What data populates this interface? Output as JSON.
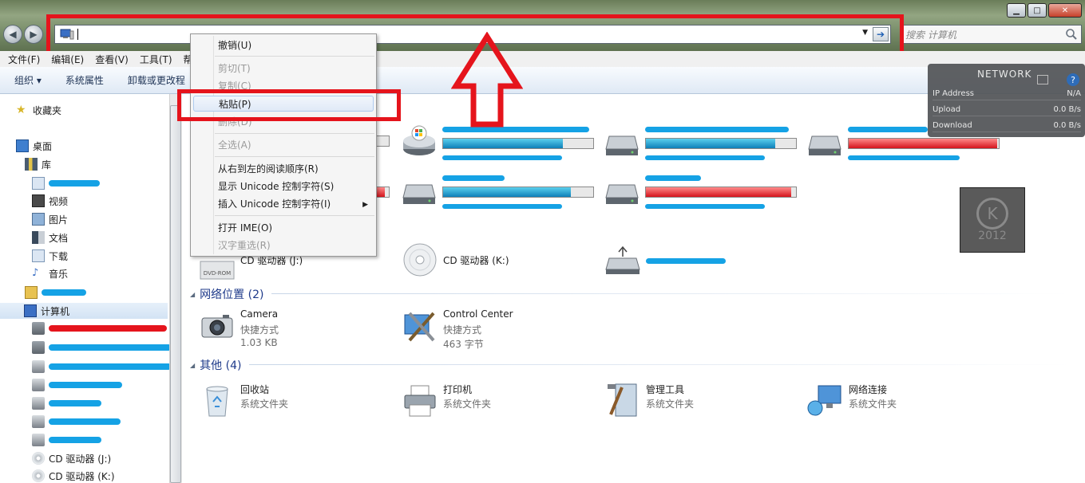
{
  "window": {
    "minimize_glyph": "▁",
    "maximize_glyph": "□",
    "close_glyph": "✕"
  },
  "nav": {
    "back_glyph": "◀",
    "forward_glyph": "▶"
  },
  "address_bar": {
    "value": "",
    "dropdown_glyph": "▼",
    "go_glyph": "➔"
  },
  "search": {
    "placeholder": "搜索 计算机"
  },
  "menubar": [
    "文件(F)",
    "编辑(E)",
    "查看(V)",
    "工具(T)",
    "帮"
  ],
  "toolbar": [
    "组织 ▾",
    "系统属性",
    "卸载或更改程"
  ],
  "sidebar": {
    "favorites": "收藏夹",
    "desktop": "桌面",
    "libraries": "库",
    "lib_items": [
      "视频",
      "图片",
      "文档",
      "下载",
      "音乐"
    ],
    "computer": "计算机",
    "drives_bottom": [
      "CD 驱动器 (J:)",
      "CD 驱动器 (K:)"
    ]
  },
  "content": {
    "cd_drives": [
      {
        "name": "CD 驱动器 (J:)",
        "icon": "dvd-rom-icon",
        "label": "DVD-ROM"
      },
      {
        "name": "CD 驱动器 (K:)",
        "icon": "cd-icon"
      }
    ],
    "network_group": "网络位置 (2)",
    "network_items": [
      {
        "name": "Camera",
        "type": "快捷方式",
        "size": "1.03 KB"
      },
      {
        "name": "Control Center",
        "type": "快捷方式",
        "size": "463 字节"
      }
    ],
    "other_group": "其他 (4)",
    "other_items": [
      {
        "name": "回收站",
        "type": "系统文件夹"
      },
      {
        "name": "打印机",
        "type": "系统文件夹"
      },
      {
        "name": "管理工具",
        "type": "系统文件夹"
      },
      {
        "name": "网络连接",
        "type": "系统文件夹"
      }
    ],
    "drive_usage": [
      0.8,
      0.86,
      0.99,
      0.98,
      0.85,
      0.97
    ],
    "drive_usage_red": [
      false,
      false,
      true,
      true,
      false,
      true
    ]
  },
  "context_menu": {
    "undo": "撤销(U)",
    "cut": "剪切(T)",
    "copy": "复制(C)",
    "paste": "粘贴(P)",
    "delete": "删除(D)",
    "select_all": "全选(A)",
    "rtl": "从右到左的阅读顺序(R)",
    "show_unicode": "显示 Unicode 控制字符(S)",
    "insert_unicode": "插入 Unicode 控制字符(I)",
    "open_ime": "打开 IME(O)",
    "reconvert": "汉字重选(R)",
    "submenu_glyph": "▶"
  },
  "gadget": {
    "title": "NETWORK",
    "rows": [
      {
        "label": "IP Address",
        "value": "N/A"
      },
      {
        "label": "Upload",
        "value": "0.0 B/s"
      },
      {
        "label": "Download",
        "value": "0.0 B/s"
      }
    ],
    "help_glyph": "?"
  },
  "k_logo": {
    "letter": "K",
    "year": "2012"
  }
}
